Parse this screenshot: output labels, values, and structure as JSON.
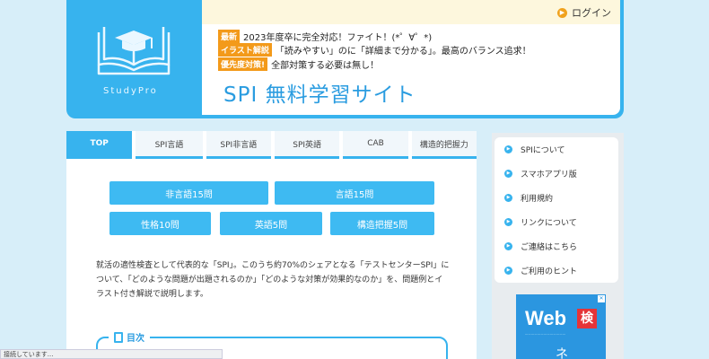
{
  "header": {
    "logo_text": "StudyPro",
    "login_label": "ログイン",
    "notices": [
      {
        "tag": "最新",
        "text": "2023年度卒に完全対応！ファイト！(*゜∀゜*)"
      },
      {
        "tag": "イラスト解説",
        "text": "「読みやすい」のに「詳細まで分かる」。最高のバランス追求！"
      },
      {
        "tag": "優先度対策!",
        "text": "全部対策する必要は無し！"
      }
    ],
    "site_title": "SPI 無料学習サイト"
  },
  "tabs": [
    {
      "label": "TOP"
    },
    {
      "label": "SPI言語"
    },
    {
      "label": "SPI非言語"
    },
    {
      "label": "SPI英語"
    },
    {
      "label": "CAB"
    },
    {
      "label": "構造的把握力"
    }
  ],
  "buttons": {
    "nongengo": "非言語15問",
    "gengo": "言語15問",
    "seikaku": "性格10問",
    "eigo": "英語5問",
    "kouzou": "構造把握5問"
  },
  "intro": "就活の適性検査として代表的な「SPI」。このうち約70%のシェアとなる「テストセンターSPI」について、「どのような問題が出題されるのか」「どのような対策が効果的なのか」を、問題例とイラスト付き解説で説明します。",
  "toc_label": "目次",
  "sidebar": {
    "items": [
      {
        "label": "SPIについて"
      },
      {
        "label": "スマホアプリ版"
      },
      {
        "label": "利用規約"
      },
      {
        "label": "リンクについて"
      },
      {
        "label": "ご連絡はこちら"
      },
      {
        "label": "ご利用のヒント"
      }
    ]
  },
  "ad": {
    "web": "Web",
    "ken": "検",
    "bottom": "ネ"
  },
  "status_text": "接続しています..."
}
